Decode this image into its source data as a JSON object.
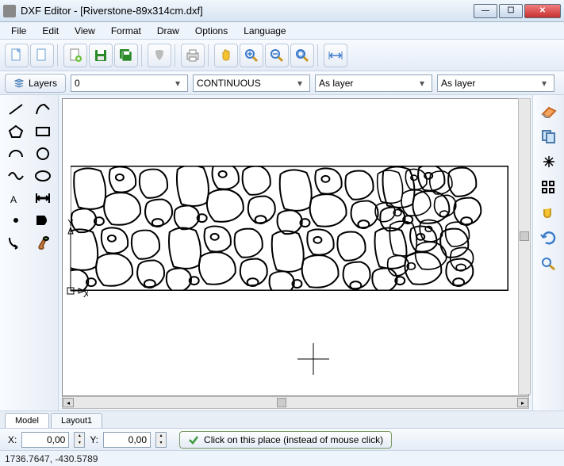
{
  "window": {
    "title": "DXF Editor - [Riverstone-89x314cm.dxf]",
    "min": "—",
    "max": "☐",
    "close": "✕"
  },
  "menu": [
    "File",
    "Edit",
    "View",
    "Format",
    "Draw",
    "Options",
    "Language"
  ],
  "toolbar_icons": [
    "new-file-icon",
    "new-blank-icon",
    "open-icon",
    "save-icon",
    "save-all-icon",
    "template-icon",
    "print-icon",
    "pan-icon",
    "zoom-in-icon",
    "zoom-out-icon",
    "zoom-window-icon",
    "fit-width-icon"
  ],
  "propbar": {
    "layers_label": "Layers",
    "layer_value": "0",
    "linetype_value": "CONTINUOUS",
    "color_value": "As layer",
    "lineweight_value": "As layer"
  },
  "left_tools": [
    "line-icon",
    "polyline-icon",
    "polygon-icon",
    "rectangle-icon",
    "arc-icon",
    "circle-icon",
    "spline-icon",
    "ellipse-icon",
    "text-icon",
    "dimension-icon",
    "point-icon",
    "hatch-icon",
    "leader-icon",
    "paint-icon"
  ],
  "right_tools": [
    "eraser-icon",
    "copy-icon",
    "explode-icon",
    "array-icon",
    "move-icon",
    "rotate-icon",
    "zoom-icon"
  ],
  "tabs": {
    "model": "Model",
    "layout1": "Layout1"
  },
  "coords": {
    "x_label": "X:",
    "y_label": "Y:",
    "x_value": "0,00",
    "y_value": "0,00",
    "click_label": "Click on this place (instead of mouse click)"
  },
  "status": {
    "pos": "1736.7647, -430.5789"
  },
  "axis": {
    "x": "X",
    "y": "Y"
  }
}
